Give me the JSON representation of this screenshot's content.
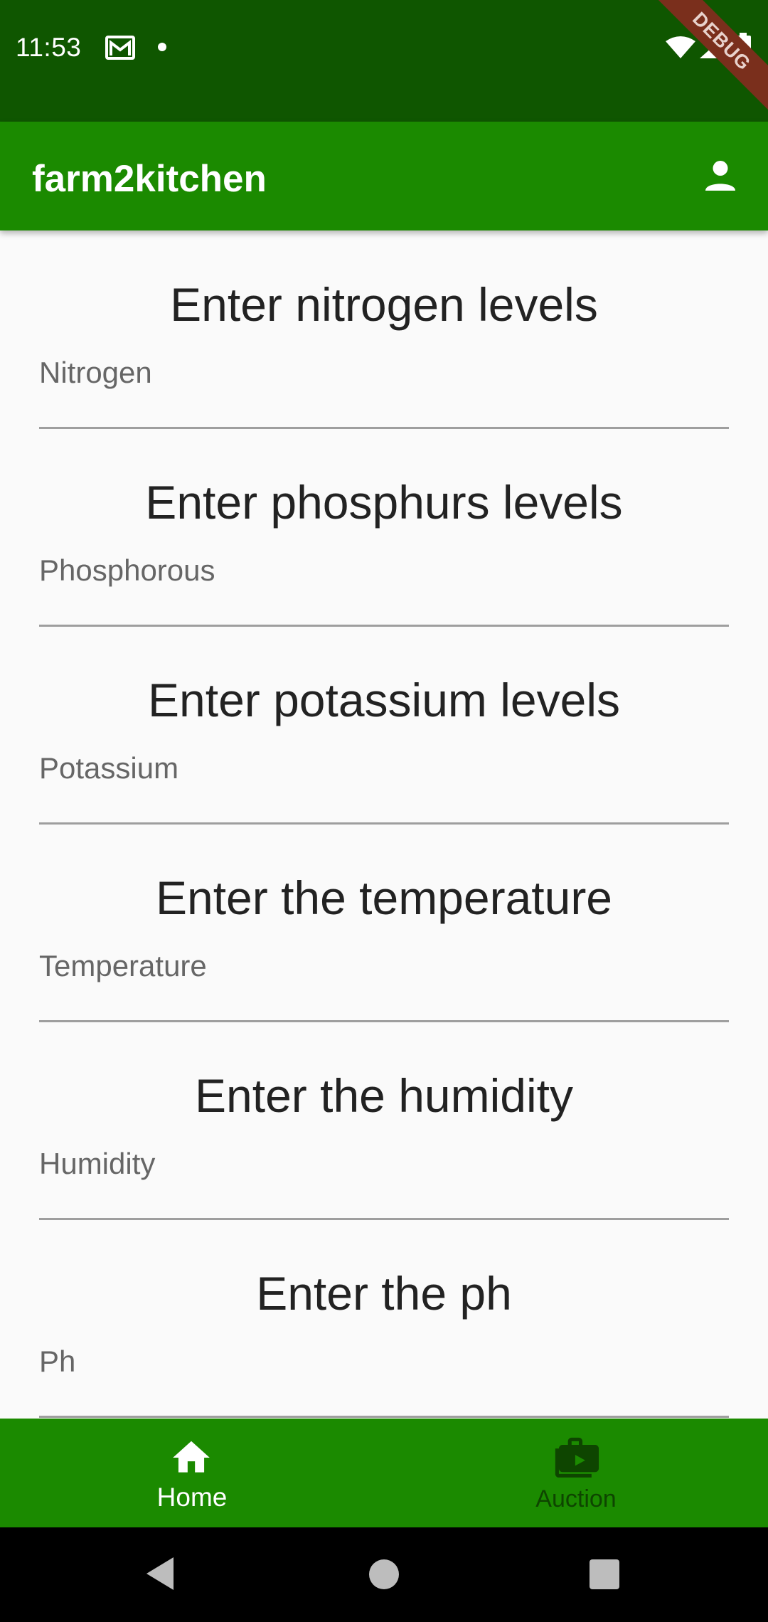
{
  "status_bar": {
    "time": "11:53",
    "debug_label": "DEBUG"
  },
  "app_bar": {
    "title": "farm2kitchen",
    "profile_icon": "person-icon"
  },
  "form": {
    "sections": [
      {
        "title": "Enter nitrogen levels",
        "placeholder": "Nitrogen"
      },
      {
        "title": "Enter phosphurs levels",
        "placeholder": "Phosphorous"
      },
      {
        "title": "Enter potassium levels",
        "placeholder": "Potassium"
      },
      {
        "title": "Enter the temperature",
        "placeholder": "Temperature"
      },
      {
        "title": "Enter the humidity",
        "placeholder": "Humidity"
      },
      {
        "title": "Enter the ph",
        "placeholder": "Ph"
      }
    ]
  },
  "bottom_nav": {
    "items": [
      {
        "label": "Home",
        "icon": "home-icon",
        "selected": true
      },
      {
        "label": "Auction",
        "icon": "auction-icon",
        "selected": false
      }
    ]
  },
  "colors": {
    "status_bar": "#0f5600",
    "primary": "#1b8a00",
    "background": "#fafafa",
    "nav_inactive": "#0e4500"
  }
}
